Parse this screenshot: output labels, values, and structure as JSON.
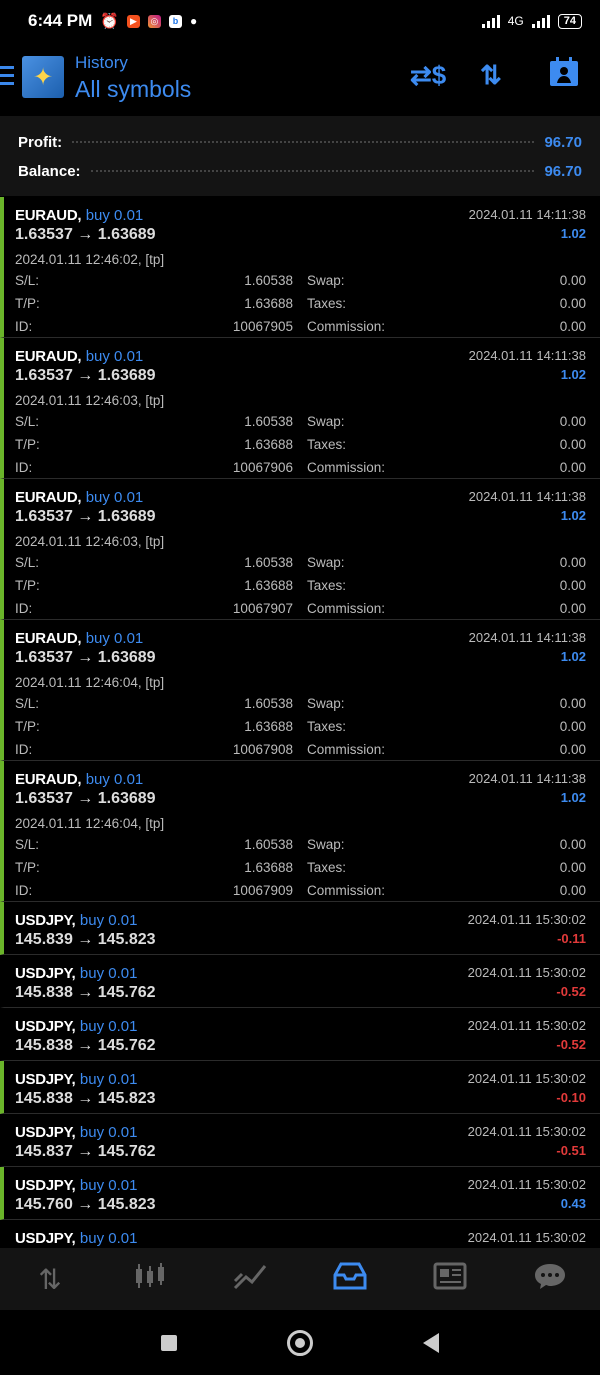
{
  "status_bar": {
    "time": "6:44 PM",
    "network": "4G",
    "battery": "74"
  },
  "header": {
    "title": "History",
    "subtitle": "All symbols"
  },
  "summary": {
    "profit_label": "Profit:",
    "profit_value": "96.70",
    "balance_label": "Balance:",
    "balance_value": "96.70"
  },
  "labels": {
    "sl": "S/L:",
    "tp": "T/P:",
    "id": "ID:",
    "swap": "Swap:",
    "taxes": "Taxes:",
    "commission": "Commission:"
  },
  "trades": [
    {
      "symbol": "EURAUD,",
      "side": "buy 0.01",
      "time": "2024.01.11 14:11:38",
      "prices": "1.63537 → 1.63689",
      "profit": "1.02",
      "opened": "2024.01.11 12:46:02, [tp]",
      "sl": "1.60538",
      "tp": "1.63688",
      "id": "10067905",
      "swap": "0.00",
      "taxes": "0.00",
      "commission": "0.00"
    },
    {
      "symbol": "EURAUD,",
      "side": "buy 0.01",
      "time": "2024.01.11 14:11:38",
      "prices": "1.63537 → 1.63689",
      "profit": "1.02",
      "opened": "2024.01.11 12:46:03, [tp]",
      "sl": "1.60538",
      "tp": "1.63688",
      "id": "10067906",
      "swap": "0.00",
      "taxes": "0.00",
      "commission": "0.00"
    },
    {
      "symbol": "EURAUD,",
      "side": "buy 0.01",
      "time": "2024.01.11 14:11:38",
      "prices": "1.63537 → 1.63689",
      "profit": "1.02",
      "opened": "2024.01.11 12:46:03, [tp]",
      "sl": "1.60538",
      "tp": "1.63688",
      "id": "10067907",
      "swap": "0.00",
      "taxes": "0.00",
      "commission": "0.00"
    },
    {
      "symbol": "EURAUD,",
      "side": "buy 0.01",
      "time": "2024.01.11 14:11:38",
      "prices": "1.63537 → 1.63689",
      "profit": "1.02",
      "opened": "2024.01.11 12:46:04, [tp]",
      "sl": "1.60538",
      "tp": "1.63688",
      "id": "10067908",
      "swap": "0.00",
      "taxes": "0.00",
      "commission": "0.00"
    },
    {
      "symbol": "EURAUD,",
      "side": "buy 0.01",
      "time": "2024.01.11 14:11:38",
      "prices": "1.63537 → 1.63689",
      "profit": "1.02",
      "opened": "2024.01.11 12:46:04, [tp]",
      "sl": "1.60538",
      "tp": "1.63688",
      "id": "10067909",
      "swap": "0.00",
      "taxes": "0.00",
      "commission": "0.00"
    },
    {
      "symbol": "USDJPY,",
      "side": "buy 0.01",
      "time": "2024.01.11 15:30:02",
      "prices": "145.839 → 145.823",
      "profit": "-0.11"
    },
    {
      "symbol": "USDJPY,",
      "side": "buy 0.01",
      "time": "2024.01.11 15:30:02",
      "prices": "145.838 → 145.762",
      "profit": "-0.52"
    },
    {
      "symbol": "USDJPY,",
      "side": "buy 0.01",
      "time": "2024.01.11 15:30:02",
      "prices": "145.838 → 145.762",
      "profit": "-0.52"
    },
    {
      "symbol": "USDJPY,",
      "side": "buy 0.01",
      "time": "2024.01.11 15:30:02",
      "prices": "145.838 → 145.823",
      "profit": "-0.10"
    },
    {
      "symbol": "USDJPY,",
      "side": "buy 0.01",
      "time": "2024.01.11 15:30:02",
      "prices": "145.837 → 145.762",
      "profit": "-0.51"
    },
    {
      "symbol": "USDJPY,",
      "side": "buy 0.01",
      "time": "2024.01.11 15:30:02",
      "prices": "145.760 → 145.823",
      "profit": "0.43"
    },
    {
      "symbol": "USDJPY,",
      "side": "buy 0.01",
      "time": "2024.01.11 15:30:02",
      "prices": "",
      "profit": ""
    }
  ],
  "colors": {
    "accent": "#3d8bf0",
    "loss": "#e23a3a",
    "selected_marker": "#6ab42a"
  },
  "bottom_nav": [
    "quotes-icon",
    "chart-icon",
    "trade-icon",
    "history-icon",
    "news-icon",
    "messages-icon"
  ]
}
